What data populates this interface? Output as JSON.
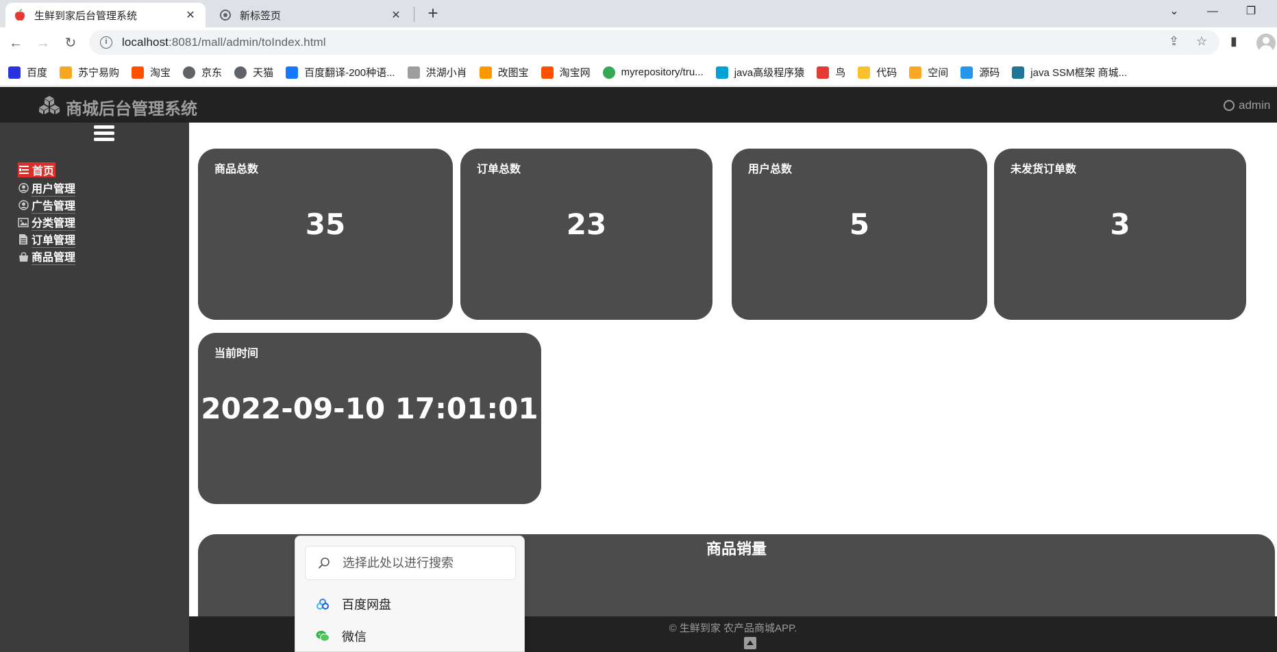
{
  "browser": {
    "tabs": [
      {
        "title": "生鲜到家后台管理系统",
        "icon": "apple-icon",
        "active": true
      },
      {
        "title": "新标签页",
        "icon": "chrome-icon",
        "active": false
      }
    ],
    "url_host": "localhost",
    "url_path": ":8081/mall/admin/toIndex.html",
    "bookmarks": [
      {
        "label": "百度",
        "icon": "baidu-paw-icon",
        "color": "#2932e1"
      },
      {
        "label": "苏宁易购",
        "icon": "suning-lion-icon",
        "color": "#f5a623"
      },
      {
        "label": "淘宝",
        "icon": "taobao-icon",
        "color": "#ff5000"
      },
      {
        "label": "京东",
        "icon": "globe-icon",
        "color": "#5f6368"
      },
      {
        "label": "天猫",
        "icon": "globe-icon",
        "color": "#5f6368"
      },
      {
        "label": "百度翻译-200种语...",
        "icon": "translate-icon",
        "color": "#1677ff"
      },
      {
        "label": "洪湖小肖",
        "icon": "cartoon-icon",
        "color": "#9e9e9e"
      },
      {
        "label": "改图宝",
        "icon": "image-edit-icon",
        "color": "#ff9800"
      },
      {
        "label": "淘宝网",
        "icon": "taobao-icon",
        "color": "#ff5000"
      },
      {
        "label": "myrepository/tru...",
        "icon": "chrome-icon",
        "color": "#34a853"
      },
      {
        "label": "java高级程序猿",
        "icon": "bilibili-icon",
        "color": "#00a1d6"
      },
      {
        "label": "鸟",
        "icon": "bird-icon",
        "color": "#e53935"
      },
      {
        "label": "代码",
        "icon": "code-icon",
        "color": "#fbc02d"
      },
      {
        "label": "空间",
        "icon": "qzone-icon",
        "color": "#f9a825"
      },
      {
        "label": "源码",
        "icon": "docker-icon",
        "color": "#2496ed"
      },
      {
        "label": "java SSM框架 商城...",
        "icon": "wordpress-icon",
        "color": "#21759b"
      }
    ]
  },
  "header": {
    "brand": "商城后台管理系统",
    "user": "admin"
  },
  "sidebar": {
    "items": [
      {
        "label": "首页",
        "icon": "list-icon",
        "active": true
      },
      {
        "label": "用户管理",
        "icon": "user-circle-icon",
        "active": false
      },
      {
        "label": "广告管理",
        "icon": "user-circle-icon",
        "active": false
      },
      {
        "label": "分类管理",
        "icon": "picture-icon",
        "active": false
      },
      {
        "label": "订单管理",
        "icon": "file-icon",
        "active": false
      },
      {
        "label": "商品管理",
        "icon": "bag-icon",
        "active": false
      }
    ]
  },
  "stats": [
    {
      "label": "商品总数",
      "value": "35"
    },
    {
      "label": "订单总数",
      "value": "23"
    },
    {
      "label": "用户总数",
      "value": "5"
    },
    {
      "label": "未发货订单数",
      "value": "3"
    }
  ],
  "time_card": {
    "label": "当前时间",
    "value": "2022-09-10 17:01:01"
  },
  "sales_panel": {
    "title": "商品销量"
  },
  "footer": {
    "text": "© 生鲜到家 农产品商城APP."
  },
  "popup": {
    "placeholder": "选择此处以进行搜索",
    "items": [
      {
        "label": "百度网盘",
        "icon": "baidu-netdisk-icon"
      },
      {
        "label": "微信",
        "icon": "wechat-icon"
      }
    ]
  }
}
